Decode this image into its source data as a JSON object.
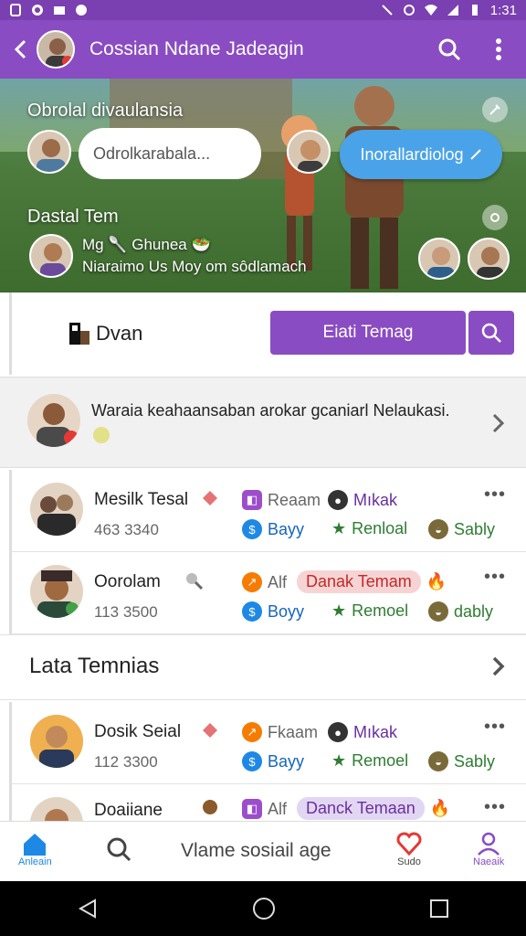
{
  "status_bar": {
    "time": "1:31"
  },
  "header": {
    "title": "Cossian Ndane Jadeagin"
  },
  "banner": {
    "heading_top": "Obrolal divaulansia",
    "input_text": "Odrolkarabala...",
    "pill_text": "Inorallardiolog",
    "heading_mid": "Dastal Tem",
    "line1": "Mg 🥄 Ghunea 🥗",
    "line2": "Niaraimo Us  Moy om sôdlamach"
  },
  "brand_row": {
    "brand": "Dvan",
    "cta": "Eiati Temag"
  },
  "feature": {
    "text": "Waraia keahaansaban arokar gcaniarl Nelaukasi."
  },
  "rows": [
    {
      "name": "Mesilk Tesal",
      "number": "463 3340",
      "t1": "Reaam",
      "t2": "Mıkak",
      "t3": "Bayy",
      "t4": "Renloal",
      "t5": "Sably"
    },
    {
      "name": "Oorolam",
      "number": "113 3500",
      "t1": "Alf",
      "t2": "Danak Temam",
      "t3": "Boyy",
      "t4": "Remoel",
      "t5": "dably"
    },
    {
      "name": "Dosik Seial",
      "number": "112 3300",
      "t1": "Fkaam",
      "t2": "Mıkak",
      "t3": "Bayy",
      "t4": "Remoel",
      "t5": "Sably"
    },
    {
      "name": "Doaiiane",
      "number": "",
      "t1": "Alf",
      "t2": "Danck Temaan"
    }
  ],
  "section": {
    "title": "Lata Temnias"
  },
  "bottom_nav": {
    "home": "Anleain",
    "center": "Vlame sosiail  age",
    "studio": "Sudo",
    "profile": "Naeaik"
  },
  "colors": {
    "primary": "#8a4cc2",
    "accent_blue": "#4aa3e8",
    "green": "#2e7d32"
  }
}
